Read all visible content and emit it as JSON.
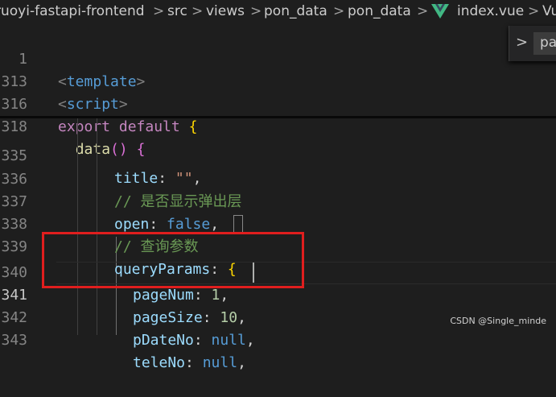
{
  "breadcrumb": {
    "items": [
      "ruoyi-fastapi-frontend",
      "src",
      "views",
      "pon_data",
      "pon_data",
      "index.vue",
      "Vu"
    ],
    "separator": ">"
  },
  "find_widget": {
    "chevron": ">",
    "value": "pa"
  },
  "sticky_lines": [
    {
      "num": "1",
      "code": "<template>"
    },
    {
      "num": "313",
      "code": "<script>"
    },
    {
      "num": "316",
      "code": "export default {"
    },
    {
      "num": "318",
      "code": "  data() {"
    }
  ],
  "lines": [
    {
      "num": "335",
      "code": "title: \"\","
    },
    {
      "num": "336",
      "code": "// 是否显示弹出层"
    },
    {
      "num": "337",
      "code": "open: false,"
    },
    {
      "num": "338",
      "code": "// 查询参数"
    },
    {
      "num": "339",
      "code": "queryParams: {"
    },
    {
      "num": "340",
      "code": "pageNum: 1,"
    },
    {
      "num": "341",
      "code": "pageSize: 10,"
    },
    {
      "num": "342",
      "code": "pDateNo: null,"
    },
    {
      "num": "343",
      "code": "teleNo: null,"
    }
  ],
  "active_line": "341",
  "watermark": "CSDN @Single_minde",
  "colors": {
    "highlight_box": "#e01e1e",
    "vue_logo": "#41b883"
  }
}
